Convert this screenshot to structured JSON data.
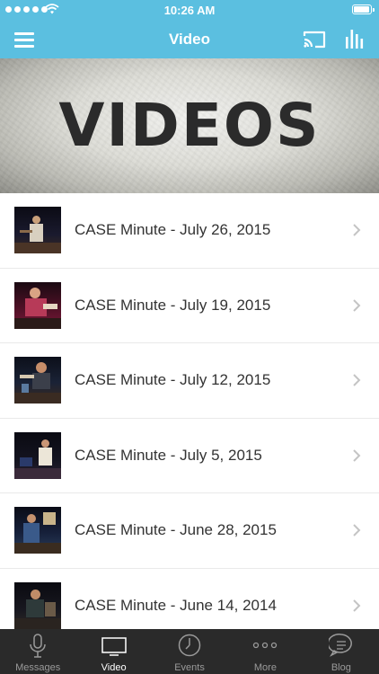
{
  "status": {
    "time": "10:26 AM"
  },
  "header": {
    "title": "Video"
  },
  "banner": {
    "text": "VIDEOS"
  },
  "videos": [
    {
      "title": "CASE Minute - July 26, 2015"
    },
    {
      "title": "CASE Minute - July 19, 2015"
    },
    {
      "title": "CASE Minute - July 12, 2015"
    },
    {
      "title": "CASE Minute - July 5, 2015"
    },
    {
      "title": "CASE Minute - June 28, 2015"
    },
    {
      "title": "CASE Minute - June 14, 2014"
    }
  ],
  "tabs": [
    {
      "label": "Messages",
      "icon": "microphone-icon"
    },
    {
      "label": "Video",
      "icon": "tv-icon"
    },
    {
      "label": "Events",
      "icon": "clock-icon"
    },
    {
      "label": "More",
      "icon": "more-dots-icon"
    },
    {
      "label": "Blog",
      "icon": "chat-bubble-icon"
    }
  ],
  "colors": {
    "accent": "#5bbfe0",
    "tabbar": "#2a2a2a",
    "text": "#333333"
  }
}
